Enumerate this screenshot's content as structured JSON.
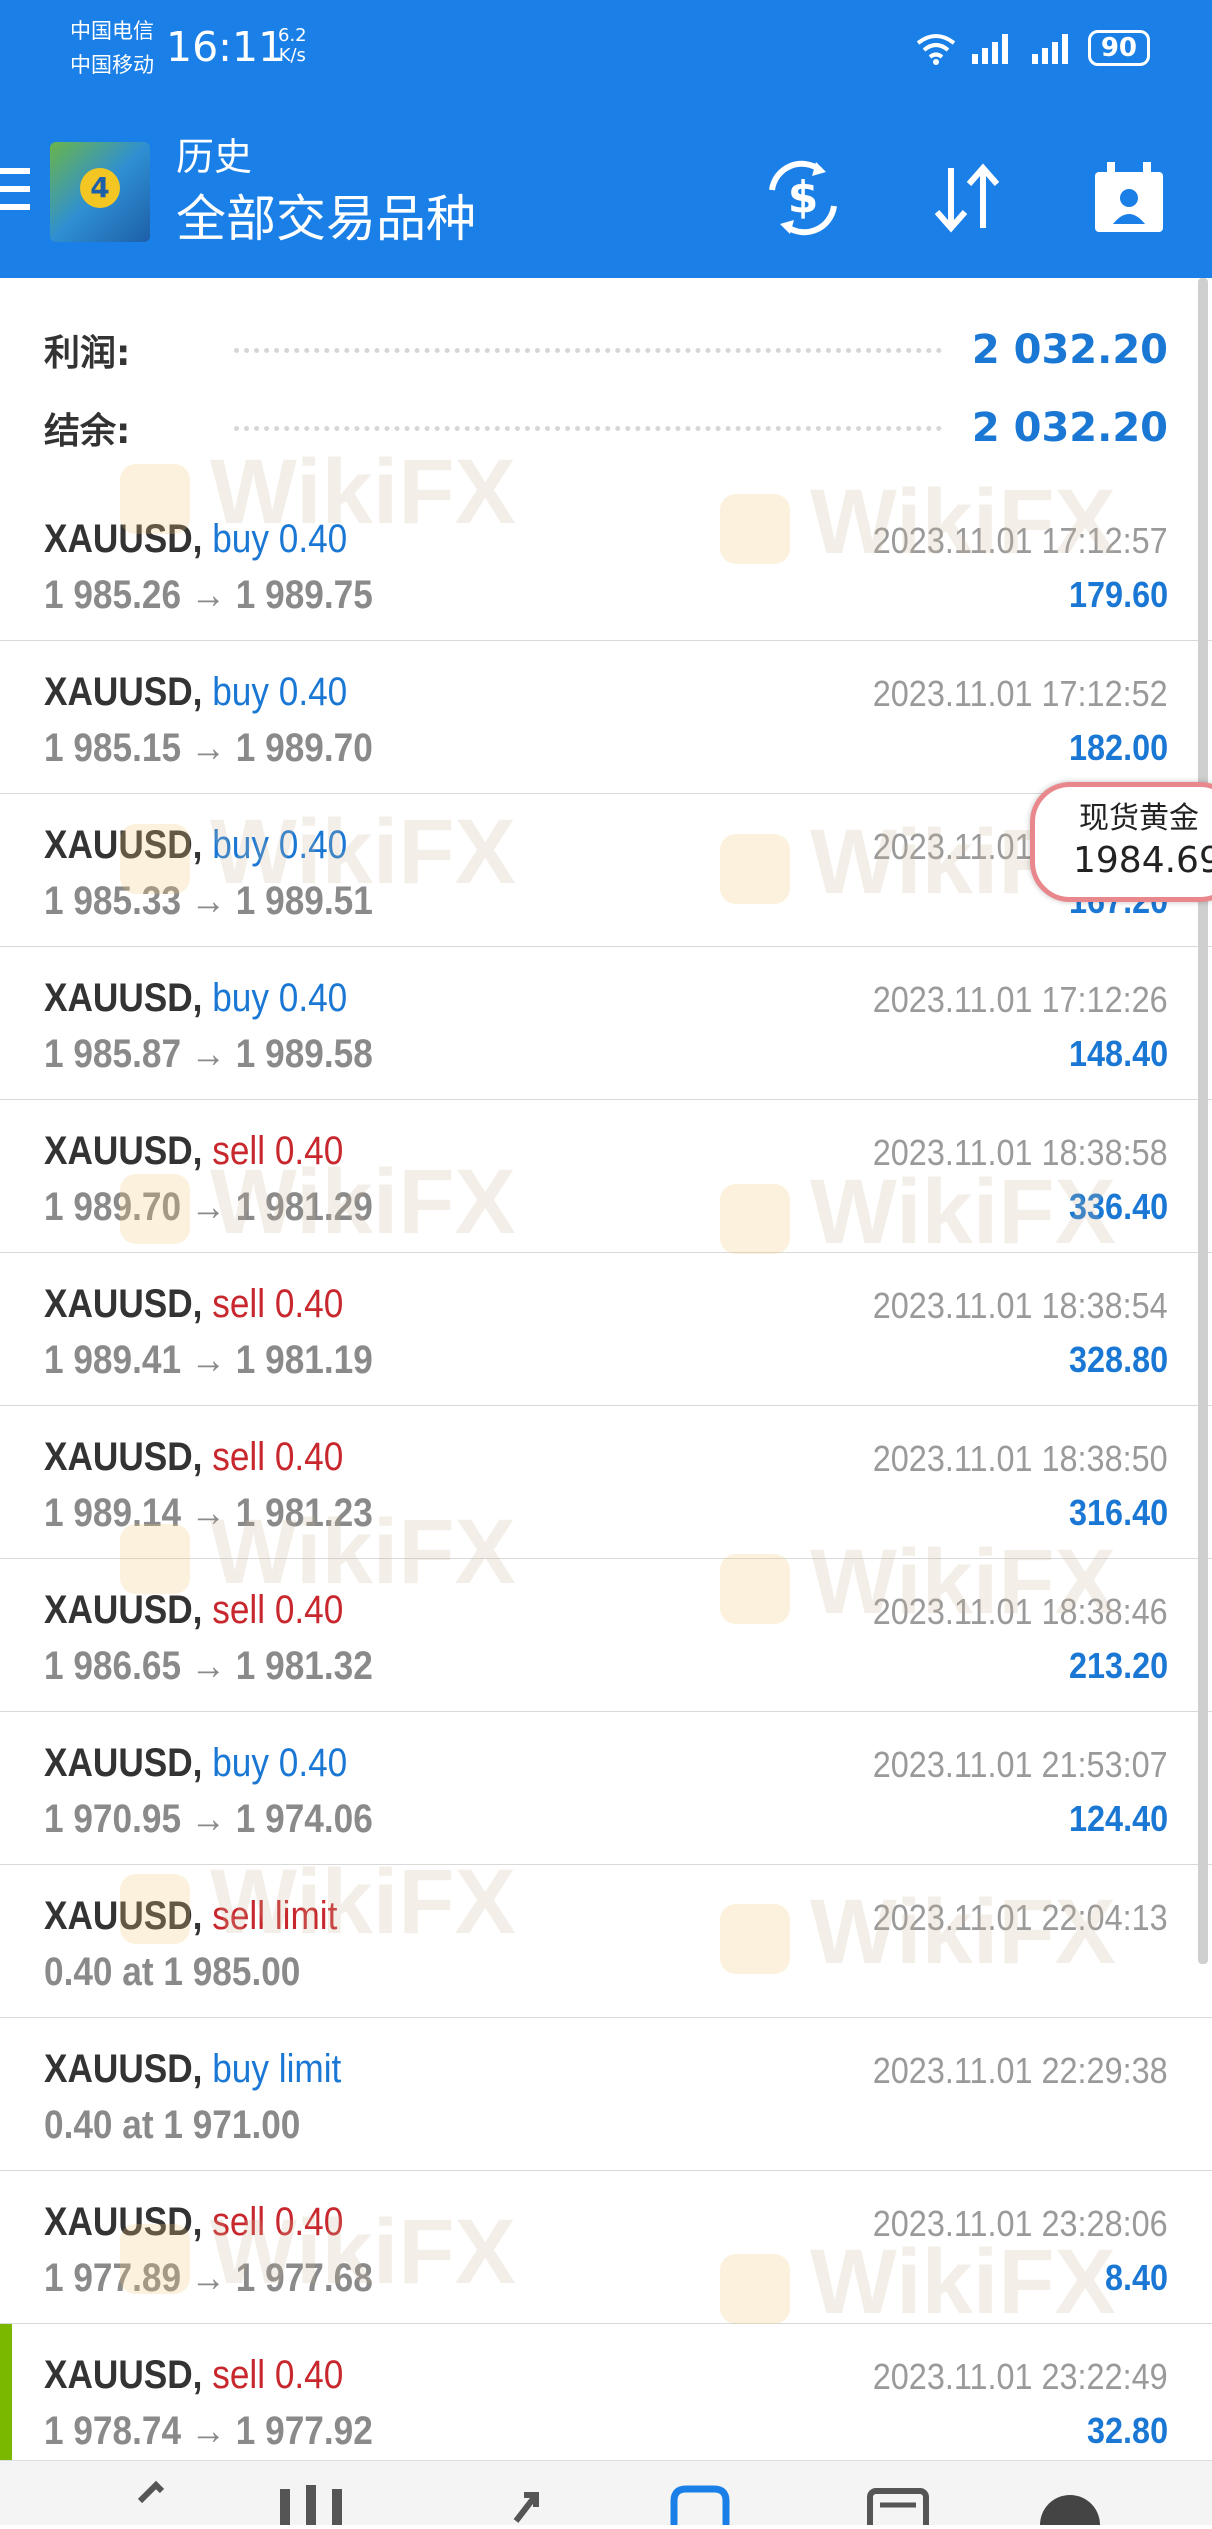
{
  "status_bar": {
    "carrier1": "中国电信",
    "carrier2": "中国移动",
    "time": "16:11",
    "speed_value": "6.2",
    "speed_unit": "K/s",
    "battery": "90"
  },
  "app_bar": {
    "subtitle": "历史",
    "title": "全部交易品种",
    "logo_number": "4"
  },
  "summary": {
    "profit_label": "利润:",
    "profit_value": "2 032.20",
    "balance_label": "结余:",
    "balance_value": "2 032.20"
  },
  "deals": [
    {
      "symbol": "XAUUSD,",
      "op": "buy 0.40",
      "side": "buy",
      "price": "1 985.26 → 1 989.75",
      "time": "2023.11.01 17:12:57",
      "profit": "179.60"
    },
    {
      "symbol": "XAUUSD,",
      "op": "buy 0.40",
      "side": "buy",
      "price": "1 985.15 → 1 989.70",
      "time": "2023.11.01 17:12:52",
      "profit": "182.00"
    },
    {
      "symbol": "XAUUSD,",
      "op": "buy 0.40",
      "side": "buy",
      "price": "1 985.33 → 1 989.51",
      "time": "2023.11.01 17:12:26",
      "profit": "167.20"
    },
    {
      "symbol": "XAUUSD,",
      "op": "buy 0.40",
      "side": "buy",
      "price": "1 985.87 → 1 989.58",
      "time": "2023.11.01 17:12:26",
      "profit": "148.40"
    },
    {
      "symbol": "XAUUSD,",
      "op": "sell 0.40",
      "side": "sell",
      "price": "1 989.70 → 1 981.29",
      "time": "2023.11.01 18:38:58",
      "profit": "336.40"
    },
    {
      "symbol": "XAUUSD,",
      "op": "sell 0.40",
      "side": "sell",
      "price": "1 989.41 → 1 981.19",
      "time": "2023.11.01 18:38:54",
      "profit": "328.80"
    },
    {
      "symbol": "XAUUSD,",
      "op": "sell 0.40",
      "side": "sell",
      "price": "1 989.14 → 1 981.23",
      "time": "2023.11.01 18:38:50",
      "profit": "316.40"
    },
    {
      "symbol": "XAUUSD,",
      "op": "sell 0.40",
      "side": "sell",
      "price": "1 986.65 → 1 981.32",
      "time": "2023.11.01 18:38:46",
      "profit": "213.20"
    },
    {
      "symbol": "XAUUSD,",
      "op": "buy 0.40",
      "side": "buy",
      "price": "1 970.95 → 1 974.06",
      "time": "2023.11.01 21:53:07",
      "profit": "124.40"
    },
    {
      "symbol": "XAUUSD,",
      "op": "sell limit",
      "side": "sell",
      "price": "0.40 at 1 985.00",
      "time": "2023.11.01 22:04:13",
      "profit": ""
    },
    {
      "symbol": "XAUUSD,",
      "op": "buy limit",
      "side": "buy",
      "price": "0.40 at 1 971.00",
      "time": "2023.11.01 22:29:38",
      "profit": ""
    },
    {
      "symbol": "XAUUSD,",
      "op": "sell 0.40",
      "side": "sell",
      "price": "1 977.89 → 1 977.68",
      "time": "2023.11.01 23:28:06",
      "profit": "8.40"
    },
    {
      "symbol": "XAUUSD,",
      "op": "sell 0.40",
      "side": "sell",
      "price": "1 978.74 → 1 977.92",
      "time": "2023.11.01 23:22:49",
      "profit": "32.80"
    }
  ],
  "bubble": {
    "label": "现货黄金",
    "value": "1984.69"
  },
  "watermark_text": "WikiFX",
  "colors": {
    "header": "#1a7fe6",
    "buy": "#1a78d4",
    "sell": "#c8282d",
    "profit": "#1a78d4",
    "accent": "#7ab800"
  }
}
